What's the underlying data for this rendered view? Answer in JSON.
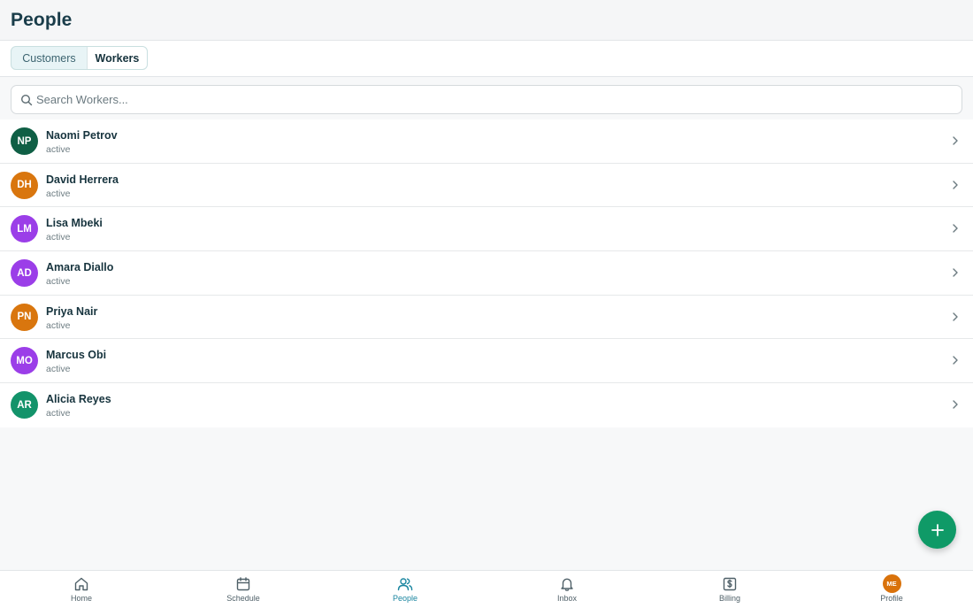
{
  "header": {
    "title": "People"
  },
  "tabs": [
    {
      "label": "Customers",
      "selected": false
    },
    {
      "label": "Workers",
      "selected": true
    }
  ],
  "search": {
    "placeholder": "Search Workers...",
    "value": ""
  },
  "workers": [
    {
      "initials": "NP",
      "name": "Naomi Petrov",
      "status": "active",
      "color": "#0f5f45"
    },
    {
      "initials": "DH",
      "name": "David Herrera",
      "status": "active",
      "color": "#d9760e"
    },
    {
      "initials": "LM",
      "name": "Lisa Mbeki",
      "status": "active",
      "color": "#9b3ee8"
    },
    {
      "initials": "AD",
      "name": "Amara Diallo",
      "status": "active",
      "color": "#9b3ee8"
    },
    {
      "initials": "PN",
      "name": "Priya Nair",
      "status": "active",
      "color": "#d9760e"
    },
    {
      "initials": "MO",
      "name": "Marcus Obi",
      "status": "active",
      "color": "#9b3ee8"
    },
    {
      "initials": "AR",
      "name": "Alicia Reyes",
      "status": "active",
      "color": "#13936a"
    }
  ],
  "fab": {
    "icon": "plus-icon",
    "color": "#0f9a67"
  },
  "nav": [
    {
      "label": "Home",
      "icon": "home-icon",
      "active": false
    },
    {
      "label": "Schedule",
      "icon": "calendar-icon",
      "active": false
    },
    {
      "label": "People",
      "icon": "people-icon",
      "active": true
    },
    {
      "label": "Inbox",
      "icon": "bell-icon",
      "active": false
    },
    {
      "label": "Billing",
      "icon": "billing-icon",
      "active": false
    },
    {
      "label": "Profile",
      "icon": "avatar",
      "active": false,
      "initials": "ME"
    }
  ],
  "colors": {
    "accent": "#1a86a0",
    "primary_green": "#0f9a67"
  }
}
